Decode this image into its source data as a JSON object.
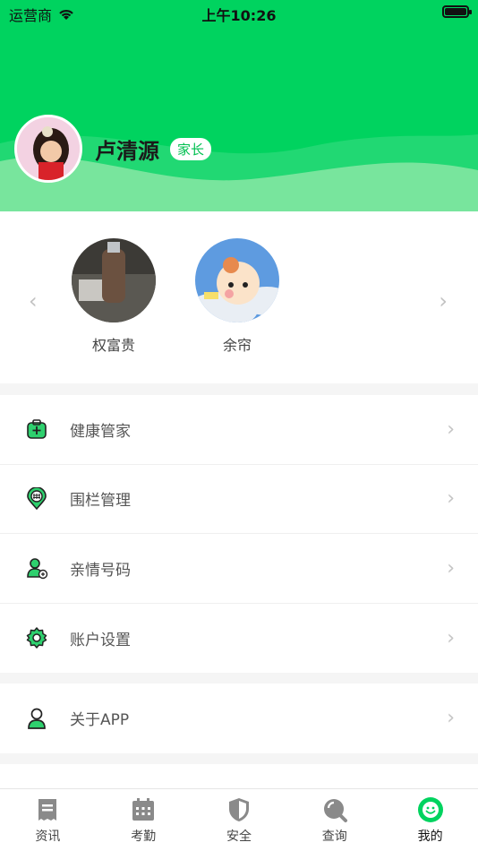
{
  "status_bar": {
    "carrier": "运营商",
    "time": "上午10:26"
  },
  "profile": {
    "name": "卢清源",
    "role": "家长"
  },
  "children": [
    {
      "name": "权富贵"
    },
    {
      "name": "余帘"
    }
  ],
  "menu": [
    {
      "label": "健康管家",
      "icon": "health-kit-icon"
    },
    {
      "label": "围栏管理",
      "icon": "fence-pin-icon"
    },
    {
      "label": "亲情号码",
      "icon": "family-contact-icon"
    },
    {
      "label": "账户设置",
      "icon": "settings-gear-icon"
    }
  ],
  "menu2": [
    {
      "label": "关于APP",
      "icon": "person-icon"
    }
  ],
  "tabbar": [
    {
      "label": "资讯",
      "icon": "news-icon"
    },
    {
      "label": "考勤",
      "icon": "calendar-icon"
    },
    {
      "label": "安全",
      "icon": "shield-icon"
    },
    {
      "label": "查询",
      "icon": "search-icon"
    },
    {
      "label": "我的",
      "icon": "smile-icon",
      "active": true
    }
  ],
  "colors": {
    "brand": "#00d35f",
    "icon_green": "#22c55e"
  }
}
